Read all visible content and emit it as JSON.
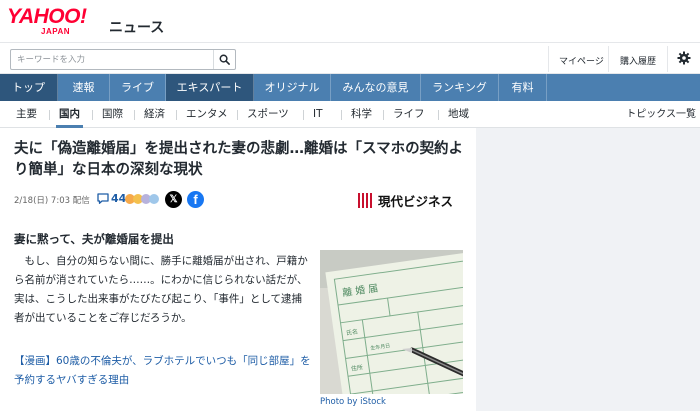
{
  "header": {
    "logo_main": "YAHOO!",
    "logo_sub": "JAPAN",
    "logo_news": "ニュース",
    "search_placeholder": "キーワードを入力",
    "mypage": "マイページ",
    "history": "購入履歴"
  },
  "nav_primary": [
    {
      "label": "トップ",
      "active": true
    },
    {
      "label": "速報"
    },
    {
      "label": "ライブ"
    },
    {
      "label": "エキスパート"
    },
    {
      "label": "オリジナル"
    },
    {
      "label": "みんなの意見"
    },
    {
      "label": "ランキング"
    },
    {
      "label": "有料"
    }
  ],
  "nav_secondary": [
    {
      "label": "主要"
    },
    {
      "label": "国内",
      "active": true
    },
    {
      "label": "国際"
    },
    {
      "label": "経済"
    },
    {
      "label": "エンタメ"
    },
    {
      "label": "スポーツ"
    },
    {
      "label": "IT"
    },
    {
      "label": "科学"
    },
    {
      "label": "ライフ"
    },
    {
      "label": "地域"
    }
  ],
  "topics_link": "トピックス一覧",
  "article": {
    "title": "夫に「偽造離婚届」を提出された妻の悲劇…離婚は「スマホの契約より簡単」な日本の深刻な現状",
    "date": "2/18(日) 7:03 配信",
    "comment_count": "44",
    "publisher": "現代ビジネス",
    "subheading": "妻に黙って、夫が離婚届を提出",
    "body": "　もし、自分の知らない間に、勝手に離婚届が出され、戸籍から名前が消されていたら……。にわかに信じられない話だが、実は、こうした出来事がたびたび起こり、「事件」として逮捕者が出ていることをご存じだろうか。",
    "related_link": "【漫画】60歳の不倫夫が、ラブホテルでいつも「同じ部屋」を予約するヤバすぎる理由",
    "photo_credit": "Photo by iStock",
    "photo_text": {
      "form_title": "離婚届",
      "name_label": "氏名",
      "birth_label": "生年月日",
      "address_label": "住所"
    }
  },
  "colors": {
    "nav_primary": "#4b7fb0",
    "nav_primary_active": "#2e567c",
    "link": "#1e5da6",
    "logo": "#ff0033",
    "brand_mark": "#c8102e"
  },
  "icons": {
    "search": "search-icon",
    "settings": "gear-icon",
    "comment": "comment-icon",
    "x": "x-logo-icon",
    "facebook": "facebook-logo-icon"
  }
}
